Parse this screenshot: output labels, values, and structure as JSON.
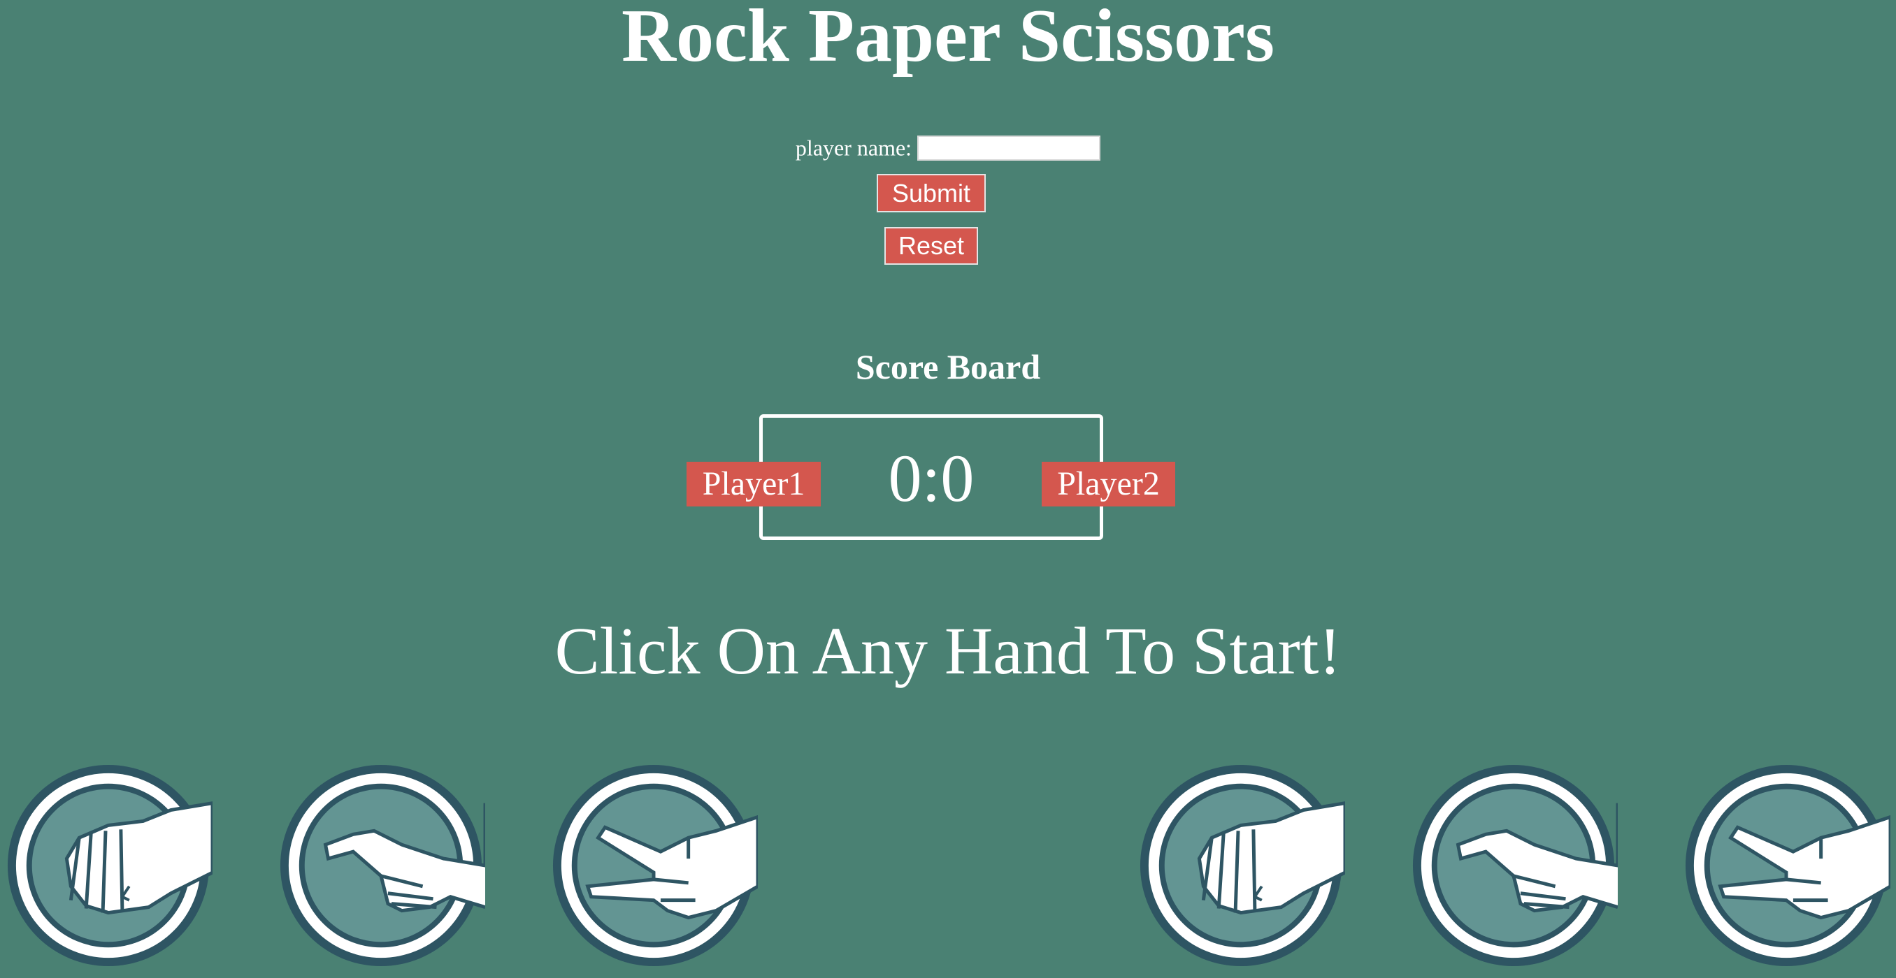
{
  "title": "Rock Paper Scissors",
  "form": {
    "name_label": "player name:",
    "name_value": "",
    "submit_label": "Submit",
    "reset_label": "Reset"
  },
  "scoreboard": {
    "title": "Score Board",
    "score": "0:0",
    "player1": "Player1",
    "player2": "Player2"
  },
  "prompt": "Click On Any Hand To Start!",
  "hands": {
    "player1": [
      "rock-icon",
      "paper-icon",
      "scissors-icon"
    ],
    "player2": [
      "rock-icon",
      "paper-icon",
      "scissors-icon"
    ]
  },
  "colors": {
    "background": "#4a8173",
    "button": "#d4574e",
    "hand_ring": "#2e5563",
    "hand_fill": "#639593"
  }
}
